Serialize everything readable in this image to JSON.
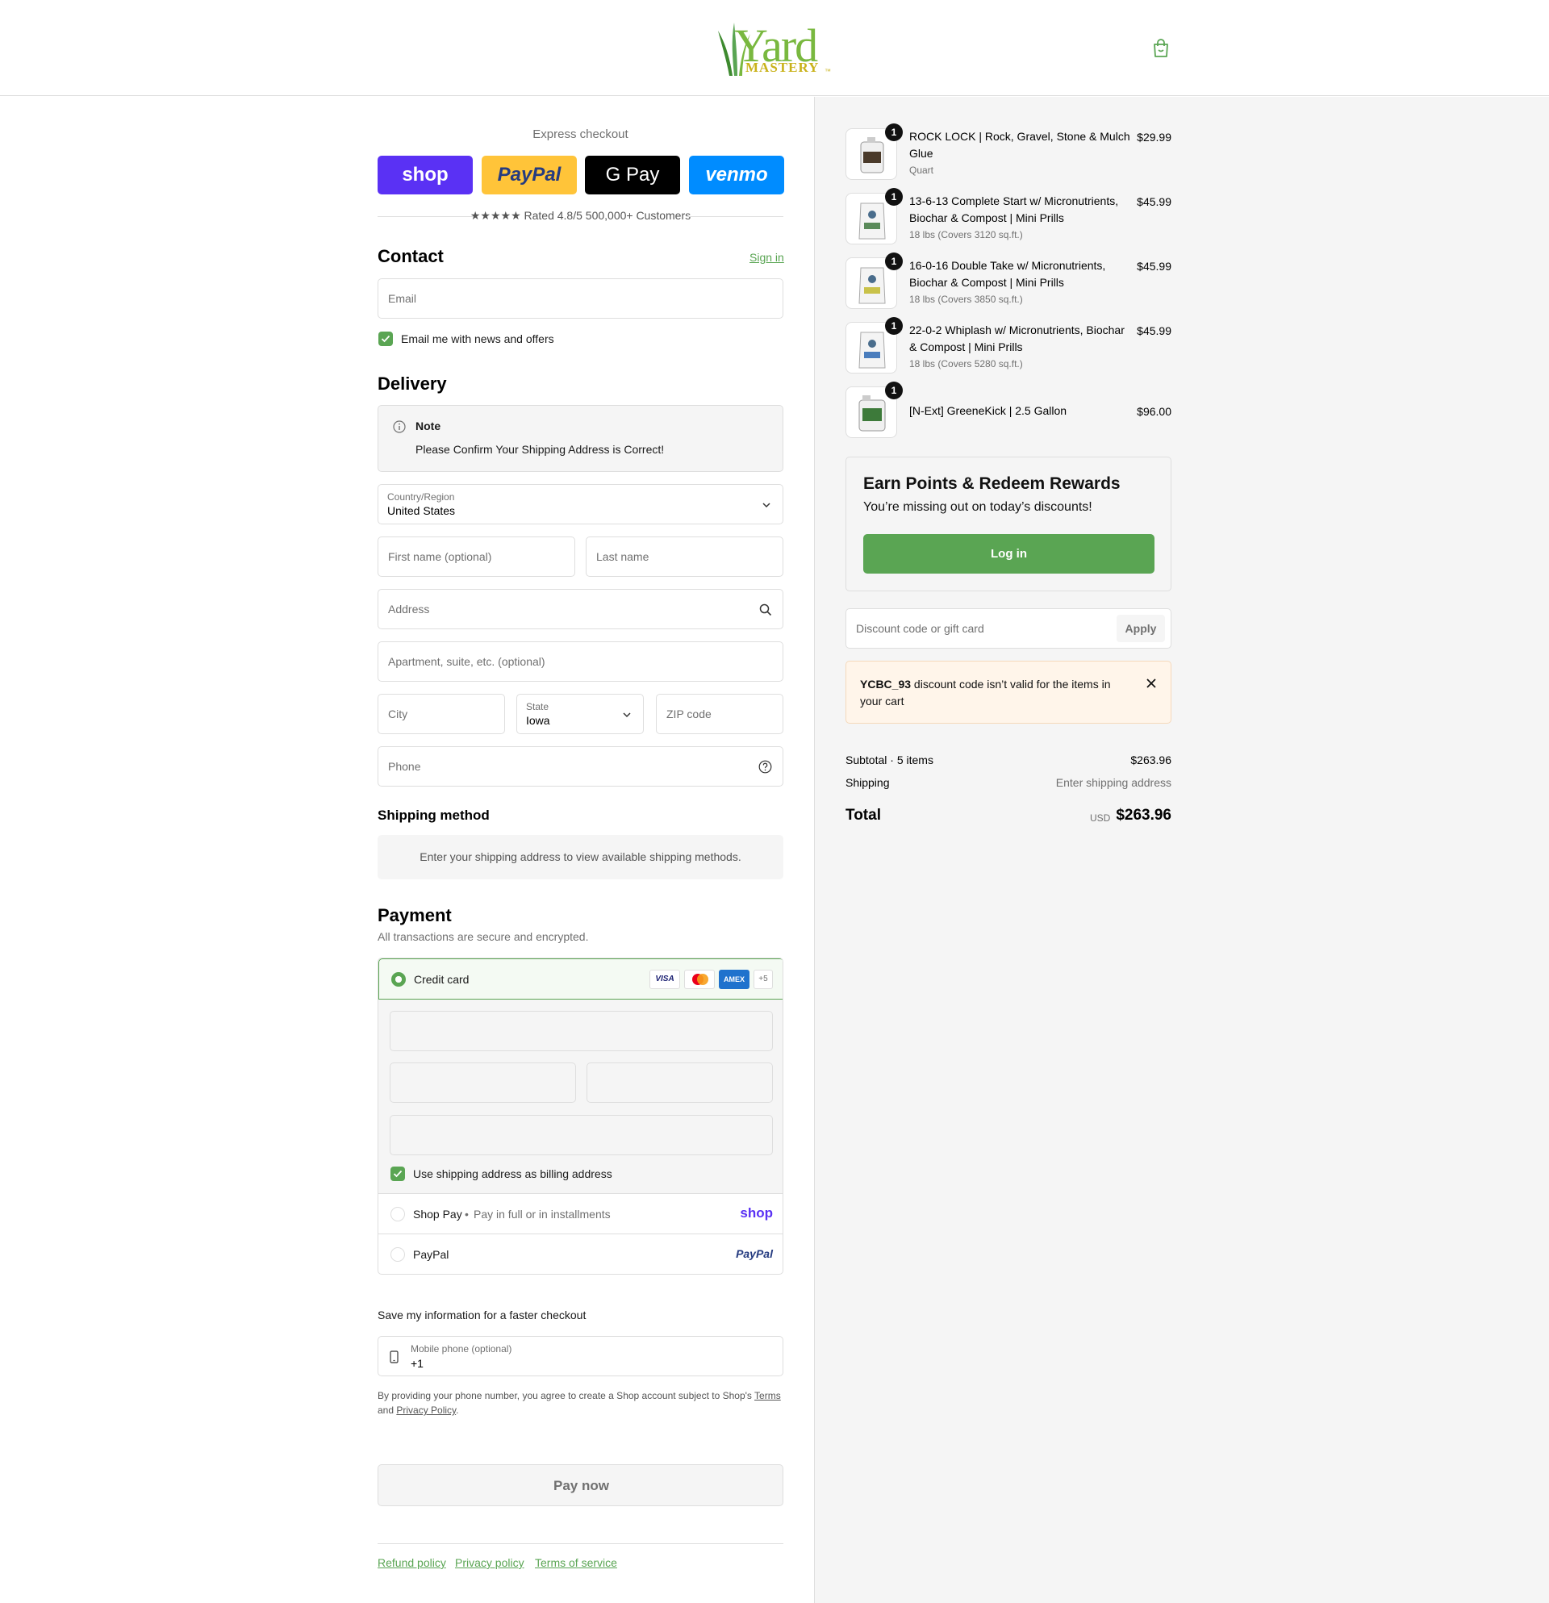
{
  "header": {
    "logo_word": "Yard",
    "logo_sub": "MASTERY",
    "logo_tm": "™"
  },
  "express": {
    "label": "Express checkout",
    "buttons": [
      {
        "label": "shop",
        "color": "#5a31f4"
      },
      {
        "label": "PayPal",
        "color": "#ffc439"
      },
      {
        "label": "G Pay",
        "color": "#000000"
      },
      {
        "label": "venmo",
        "color": "#008cff"
      }
    ],
    "rated_text": "★★★★★ Rated 4.8/5 500,000+ Customers"
  },
  "contact": {
    "title": "Contact",
    "sign_in": "Sign in",
    "email_placeholder": "Email",
    "news_label": "Email me with news and offers"
  },
  "delivery": {
    "title": "Delivery",
    "note_title": "Note",
    "note_text": "Please Confirm Your Shipping Address is Correct!",
    "country_label": "Country/Region",
    "country_value": "United States",
    "first_name_placeholder": "First name (optional)",
    "last_name_placeholder": "Last name",
    "address_placeholder": "Address",
    "apartment_placeholder": "Apartment, suite, etc. (optional)",
    "city_placeholder": "City",
    "state_label": "State",
    "state_value": "Iowa",
    "zip_placeholder": "ZIP code",
    "phone_placeholder": "Phone"
  },
  "shipping_method": {
    "title": "Shipping method",
    "message": "Enter your shipping address to view available shipping methods."
  },
  "payment": {
    "title": "Payment",
    "subtitle": "All transactions are secure and encrypted.",
    "credit_card_label": "Credit card",
    "card_brands": [
      "VISA",
      "MC",
      "AMEX"
    ],
    "more_cards": "+5",
    "billing_label": "Use shipping address as billing address",
    "shop_pay_label": "Shop Pay",
    "shop_pay_sub": "Pay in full or in installments",
    "shop_pay_logo": "shop",
    "paypal_label": "PayPal",
    "paypal_logo": "PayPal"
  },
  "save_info": {
    "title": "Save my information for a faster checkout",
    "mobile_label": "Mobile phone (optional)",
    "mobile_value": "+1",
    "disclaimer_1": "By providing your phone number, you agree to create a Shop account subject to Shop's ",
    "terms": "Terms",
    "disclaimer_2": "and ",
    "privacy": "Privacy Policy",
    "period": "."
  },
  "pay_now": "Pay now",
  "footer_links": [
    "Refund policy",
    "Privacy policy",
    "Terms of service"
  ],
  "cart": {
    "items": [
      {
        "title": "ROCK LOCK | Rock, Gravel, Stone & Mulch Glue",
        "variant": "Quart",
        "price": "$29.99",
        "qty": "1"
      },
      {
        "title": "13-6-13 Complete Start w/ Micronutrients, Biochar & Compost | Mini Prills",
        "variant": "18 lbs (Covers 3120 sq.ft.)",
        "price": "$45.99",
        "qty": "1"
      },
      {
        "title": "16-0-16 Double Take w/ Micronutrients, Biochar & Compost | Mini Prills",
        "variant": "18 lbs (Covers 3850 sq.ft.)",
        "price": "$45.99",
        "qty": "1"
      },
      {
        "title": "22-0-2 Whiplash w/ Micronutrients, Biochar & Compost | Mini Prills",
        "variant": "18 lbs (Covers 5280 sq.ft.)",
        "price": "$45.99",
        "qty": "1"
      },
      {
        "title": "[N-Ext] GreeneKick | 2.5 Gallon",
        "variant": "",
        "price": "$96.00",
        "qty": "1"
      }
    ],
    "rewards_title": "Earn Points & Redeem Rewards",
    "rewards_sub": "You’re missing out on today’s discounts!",
    "login": "Log in",
    "discount_placeholder": "Discount code or gift card",
    "apply": "Apply",
    "error_code": "YCBC_93",
    "error_text": " discount code isn’t valid for the items in your cart",
    "subtotal_label": "Subtotal · 5 items",
    "subtotal_value": "$263.96",
    "shipping_label": "Shipping",
    "shipping_value": "Enter shipping address",
    "total_label": "Total",
    "currency": "USD",
    "total_value": "$263.96"
  },
  "colors": {
    "accent": "#5aa553",
    "error_bg": "#fff5ea"
  }
}
